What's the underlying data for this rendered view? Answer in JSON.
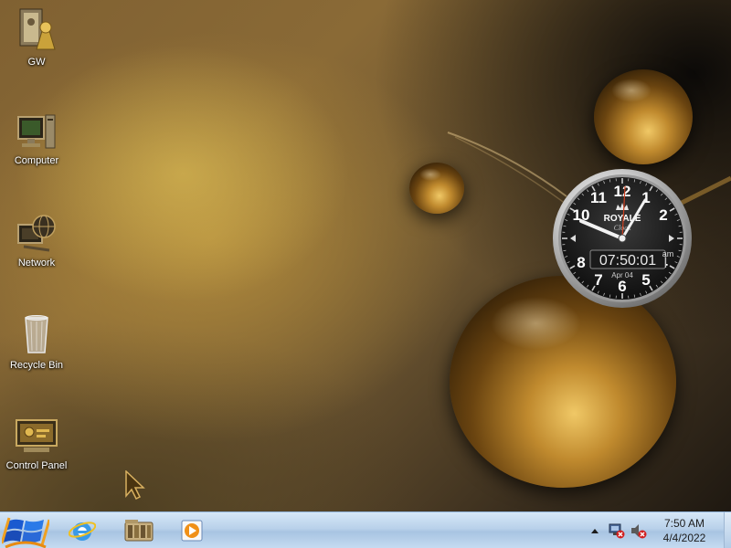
{
  "desktop": {
    "icons": [
      {
        "label": "GW",
        "icon": "user-folder-icon"
      },
      {
        "label": "Computer",
        "icon": "computer-icon"
      },
      {
        "label": "Network",
        "icon": "network-globe-icon"
      },
      {
        "label": "Recycle Bin",
        "icon": "recycle-bin-icon"
      },
      {
        "label": "Control Panel",
        "icon": "control-panel-icon"
      }
    ]
  },
  "clock_gadget": {
    "brand": "ROYALE",
    "brand_sub": "Clock",
    "digital_time": "07:50:01",
    "am_pm": "am",
    "date": "Apr 04",
    "dial_numbers": [
      "12",
      "1",
      "2",
      "4",
      "5",
      "6",
      "7",
      "8",
      "10",
      "11"
    ]
  },
  "taskbar": {
    "pinned": [
      {
        "name": "internet-explorer",
        "icon": "internet-explorer-icon"
      },
      {
        "name": "file-explorer",
        "icon": "library-folder-icon"
      },
      {
        "name": "media-player",
        "icon": "media-player-icon"
      }
    ],
    "tray": {
      "time": "7:50 AM",
      "date": "4/4/2022",
      "icons": [
        "show-hidden-icons-arrow",
        "network-disconnected-icon",
        "volume-muted-icon"
      ]
    }
  },
  "colors": {
    "taskbar_top": "#d6e7f7",
    "taskbar_bottom": "#a8c4e2",
    "wallpaper_gold": "#b08a3c",
    "wallpaper_dark": "#1a150f"
  }
}
